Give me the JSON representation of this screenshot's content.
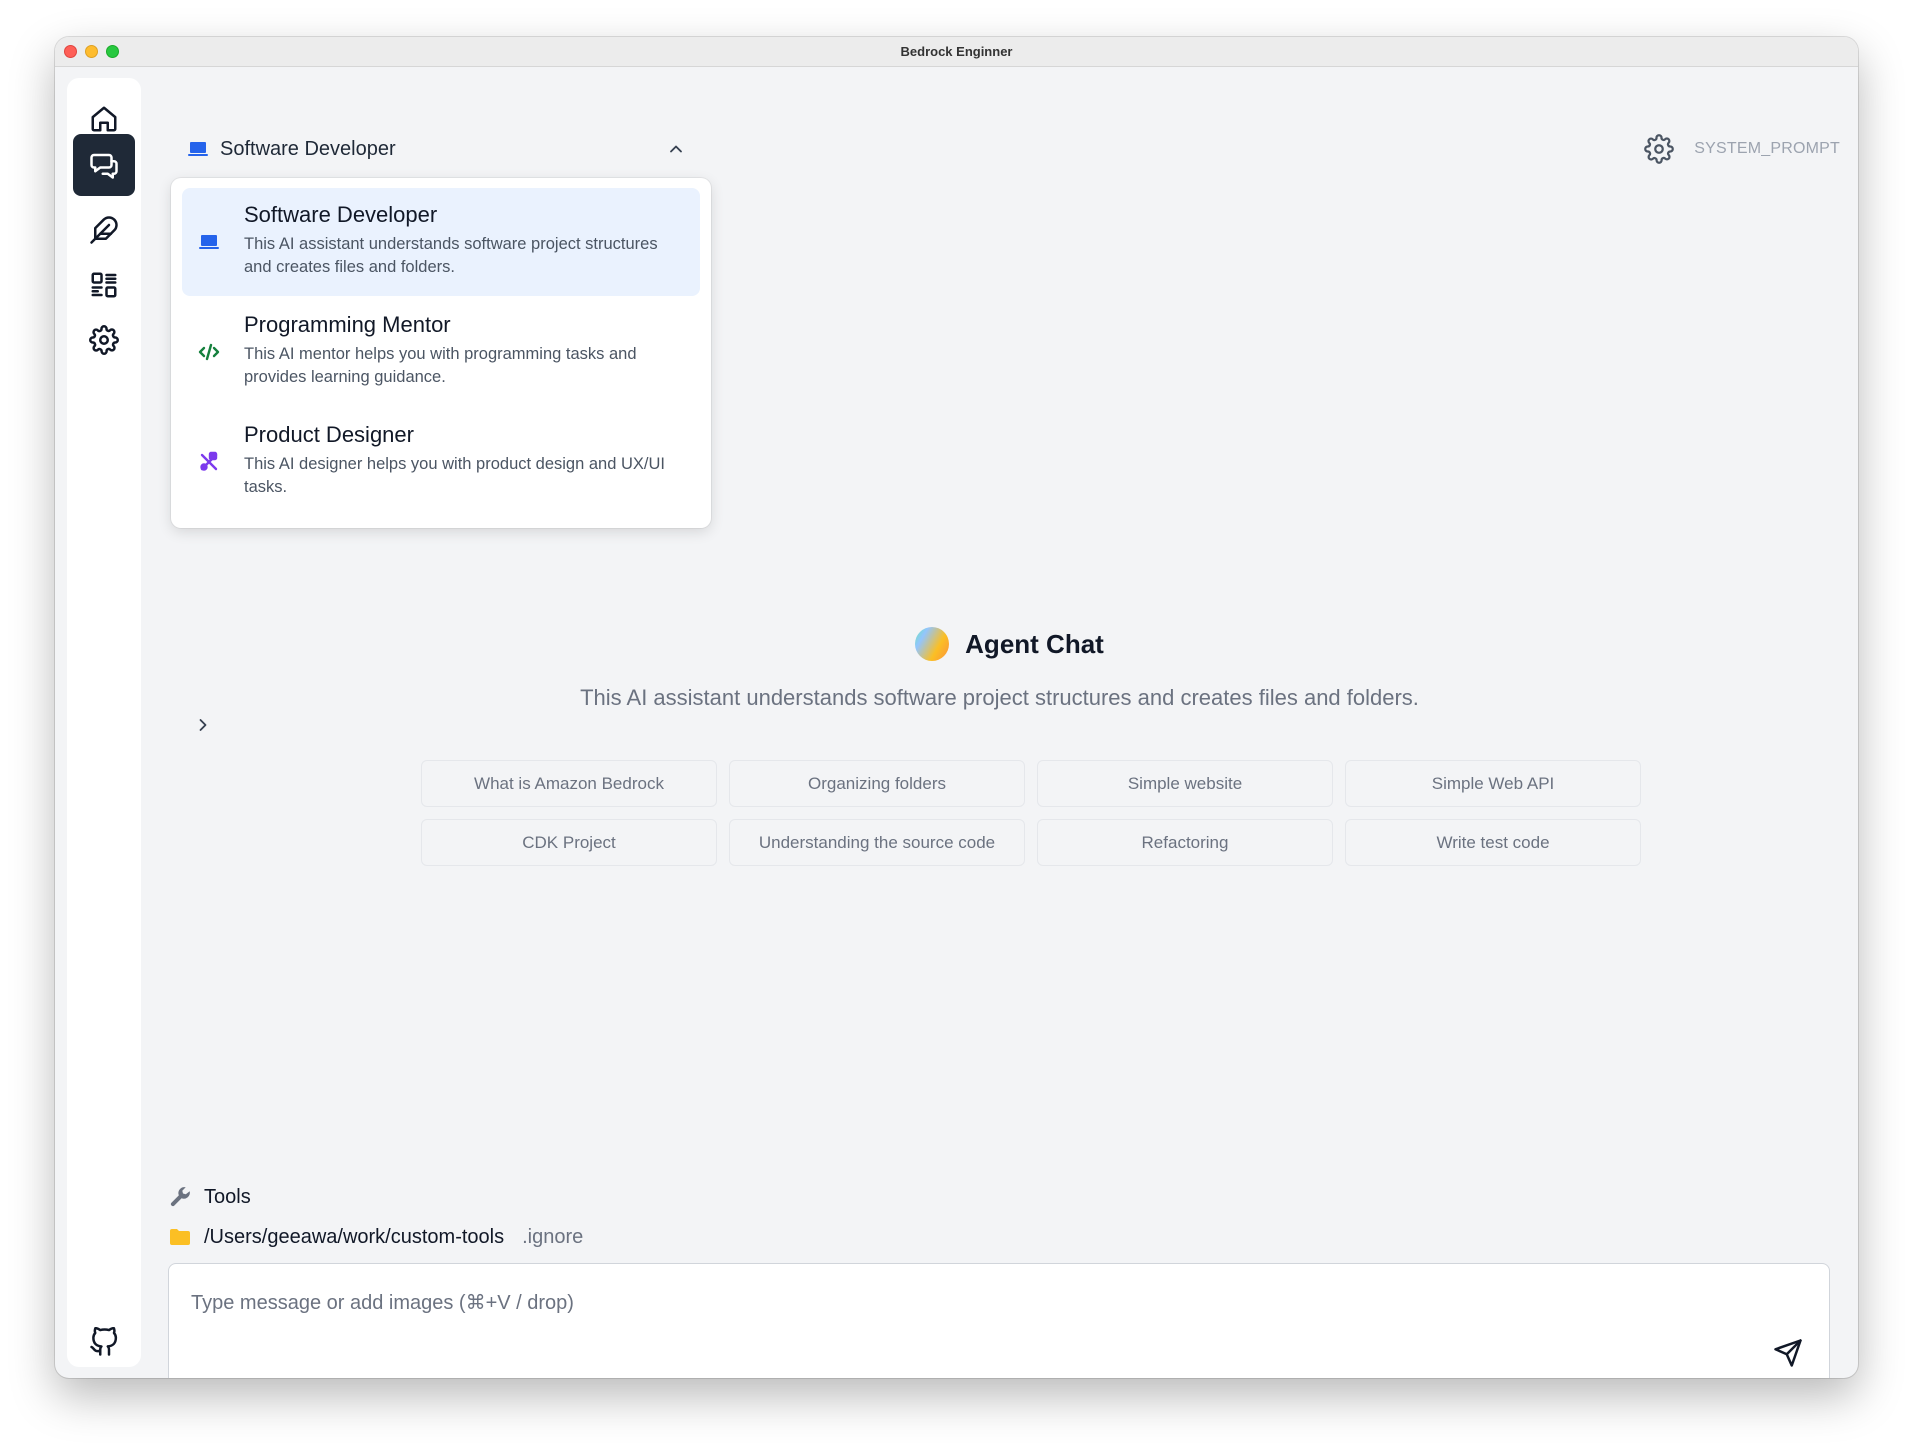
{
  "window": {
    "title": "Bedrock Enginner"
  },
  "sidebar": {
    "items": [
      {
        "name": "home",
        "icon": "home-icon",
        "active": false
      },
      {
        "name": "chat",
        "icon": "chat-icon",
        "active": true
      },
      {
        "name": "feather",
        "icon": "feather-icon",
        "active": false
      },
      {
        "name": "apps",
        "icon": "apps-icon",
        "active": false
      },
      {
        "name": "settings",
        "icon": "gear-icon",
        "active": false
      }
    ],
    "bottom": {
      "icon": "github-icon"
    }
  },
  "agent_selector": {
    "current": "Software Developer",
    "icon": "laptop-icon",
    "options": [
      {
        "title": "Software Developer",
        "description": "This AI assistant understands software project structures and creates files and folders.",
        "icon": "laptop-icon",
        "selected": true
      },
      {
        "title": "Programming Mentor",
        "description": "This AI mentor helps you with programming tasks and provides learning guidance.",
        "icon": "code-icon",
        "selected": false
      },
      {
        "title": "Product Designer",
        "description": "This AI designer helps you with product design and UX/UI tasks.",
        "icon": "design-tools-icon",
        "selected": false
      }
    ]
  },
  "header": {
    "system_prompt_label": "SYSTEM_PROMPT"
  },
  "hero": {
    "title": "Agent Chat",
    "description": "This AI assistant understands software project structures and creates files and folders."
  },
  "examples": [
    "What is Amazon Bedrock",
    "Organizing folders",
    "Simple website",
    "Simple Web API",
    "CDK Project",
    "Understanding the source code",
    "Refactoring",
    "Write test code"
  ],
  "tools": {
    "label": "Tools"
  },
  "project": {
    "path": "/Users/geeawa/work/custom-tools",
    "ignore_label": ".ignore"
  },
  "input": {
    "placeholder": "Type message or add images (⌘+V / drop)",
    "value": ""
  },
  "colors": {
    "accent_blue": "#2563eb",
    "code_green": "#15803d",
    "designer_purple": "#7c3aed",
    "folder_yellow": "#fbbf24",
    "active_nav": "#1f2937",
    "selected_option_bg": "#eaf2fe"
  }
}
